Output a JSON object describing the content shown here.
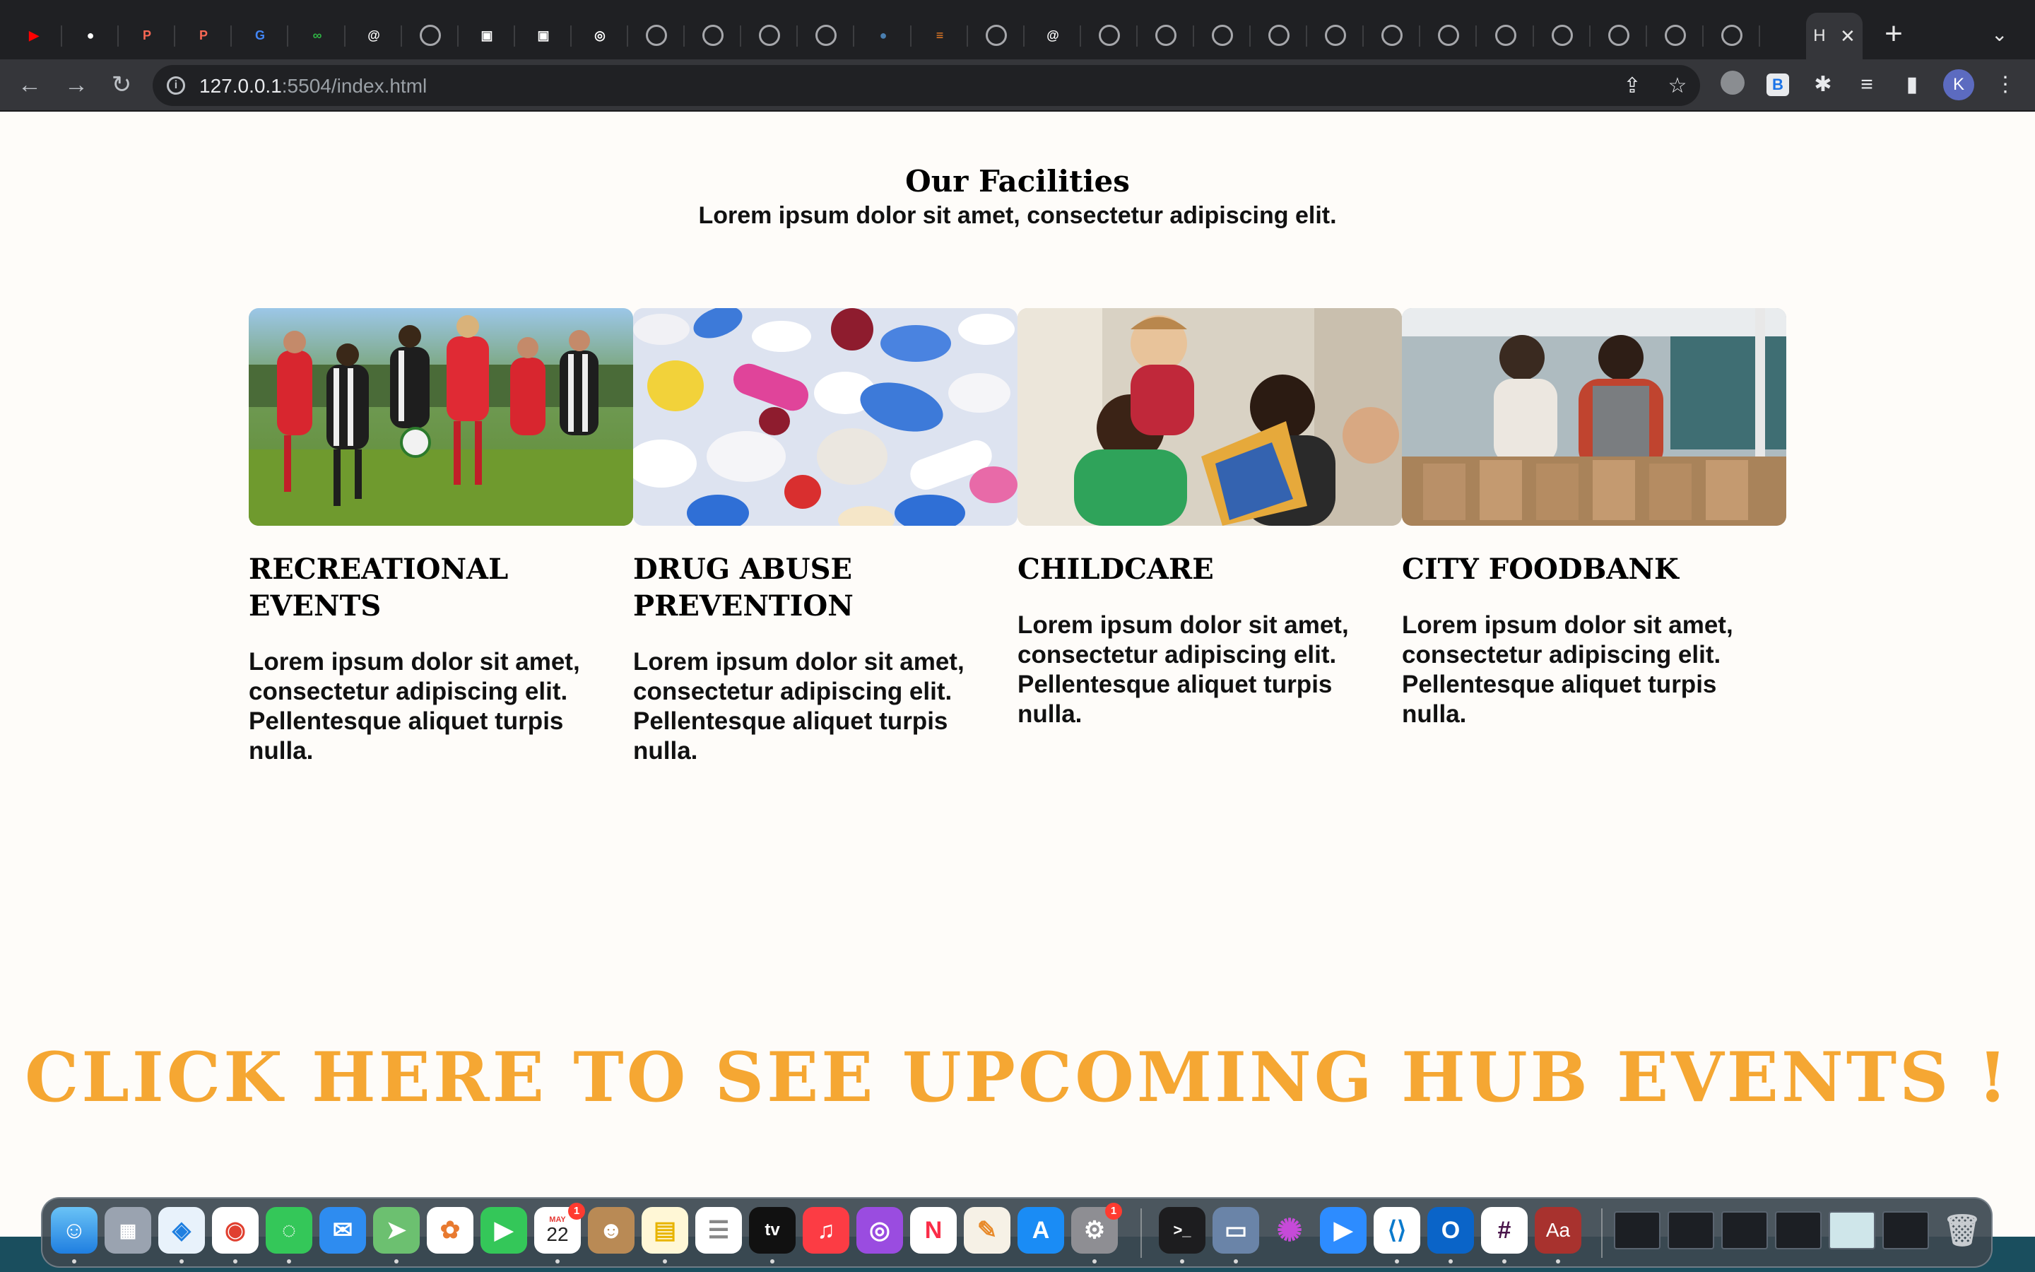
{
  "browser": {
    "url_host": "127.0.0.1",
    "url_path": ":5504/index.html",
    "active_tab_label": "H",
    "profile_initial": "K",
    "tabs": [
      {
        "icon": "youtube-icon",
        "glyph": "▶",
        "color": "#ff0000"
      },
      {
        "icon": "github-icon",
        "glyph": "●",
        "color": "#ffffff"
      },
      {
        "icon": "patreon-icon",
        "glyph": "P",
        "color": "#f96854"
      },
      {
        "icon": "patreon-icon",
        "glyph": "P",
        "color": "#f96854"
      },
      {
        "icon": "google-icon",
        "glyph": "G",
        "color": "#4285f4"
      },
      {
        "icon": "link-icon",
        "glyph": "∞",
        "color": "#2fb344"
      },
      {
        "icon": "spiral-icon",
        "glyph": "@",
        "color": "#ffffff"
      },
      {
        "icon": "globe-icon",
        "glyph": "",
        "color": "globe"
      },
      {
        "icon": "folder-icon",
        "glyph": "▣",
        "color": "#ffffff"
      },
      {
        "icon": "folder-icon",
        "glyph": "▣",
        "color": "#ffffff"
      },
      {
        "icon": "chrome-icon",
        "glyph": "◎",
        "color": "#ffffff"
      },
      {
        "icon": "globe-icon",
        "glyph": "",
        "color": "globe"
      },
      {
        "icon": "globe-icon",
        "glyph": "",
        "color": "globe"
      },
      {
        "icon": "globe-icon",
        "glyph": "",
        "color": "globe"
      },
      {
        "icon": "globe-icon",
        "glyph": "",
        "color": "globe"
      },
      {
        "icon": "earth-icon",
        "glyph": "●",
        "color": "#4a7fb0"
      },
      {
        "icon": "stackoverflow-icon",
        "glyph": "≡",
        "color": "#f48024"
      },
      {
        "icon": "globe-icon",
        "glyph": "",
        "color": "globe"
      },
      {
        "icon": "spiral-icon",
        "glyph": "@",
        "color": "#ffffff"
      },
      {
        "icon": "globe-icon",
        "glyph": "",
        "color": "globe"
      },
      {
        "icon": "globe-icon",
        "glyph": "",
        "color": "globe"
      },
      {
        "icon": "globe-icon",
        "glyph": "",
        "color": "globe"
      },
      {
        "icon": "globe-icon",
        "glyph": "",
        "color": "globe"
      },
      {
        "icon": "globe-icon",
        "glyph": "",
        "color": "globe"
      },
      {
        "icon": "globe-icon",
        "glyph": "",
        "color": "globe"
      },
      {
        "icon": "globe-icon",
        "glyph": "",
        "color": "globe"
      },
      {
        "icon": "globe-icon",
        "glyph": "",
        "color": "globe"
      },
      {
        "icon": "globe-icon",
        "glyph": "",
        "color": "globe"
      },
      {
        "icon": "globe-icon",
        "glyph": "",
        "color": "globe"
      },
      {
        "icon": "globe-icon",
        "glyph": "",
        "color": "globe"
      },
      {
        "icon": "globe-icon",
        "glyph": "",
        "color": "globe"
      }
    ]
  },
  "page": {
    "title": "Our Facilities",
    "subtitle": "Lorem ipsum dolor sit amet, consectetur adipiscing elit.",
    "cards": [
      {
        "title": "Recreational Events",
        "body": "Lorem ipsum dolor sit amet, consectetur adipiscing elit. Pellentesque aliquet turpis nulla.",
        "photo": "soccer-players-photo"
      },
      {
        "title": "Drug Abuse Prevention",
        "body": "Lorem ipsum dolor sit amet, consectetur adipiscing elit. Pellentesque aliquet turpis nulla.",
        "photo": "pills-photo"
      },
      {
        "title": "Childcare",
        "body": "Lorem ipsum dolor sit amet, consectetur adipiscing elit. Pellentesque aliquet turpis nulla.",
        "photo": "children-reading-photo"
      },
      {
        "title": "City Foodbank",
        "body": "Lorem ipsum dolor sit amet, consectetur adipiscing elit. Pellentesque aliquet turpis nulla.",
        "photo": "food-bank-volunteers-photo"
      }
    ],
    "cta": "CLICK HERE TO SEE UPCOMING HUB EVENTS !",
    "cta_color": "#f5a733"
  },
  "dock": {
    "calendar_month": "MAY",
    "calendar_day": "22",
    "calendar_badge": "1",
    "settings_badge": "1",
    "tv_label": "tv",
    "dictionary_label": "Aa"
  }
}
